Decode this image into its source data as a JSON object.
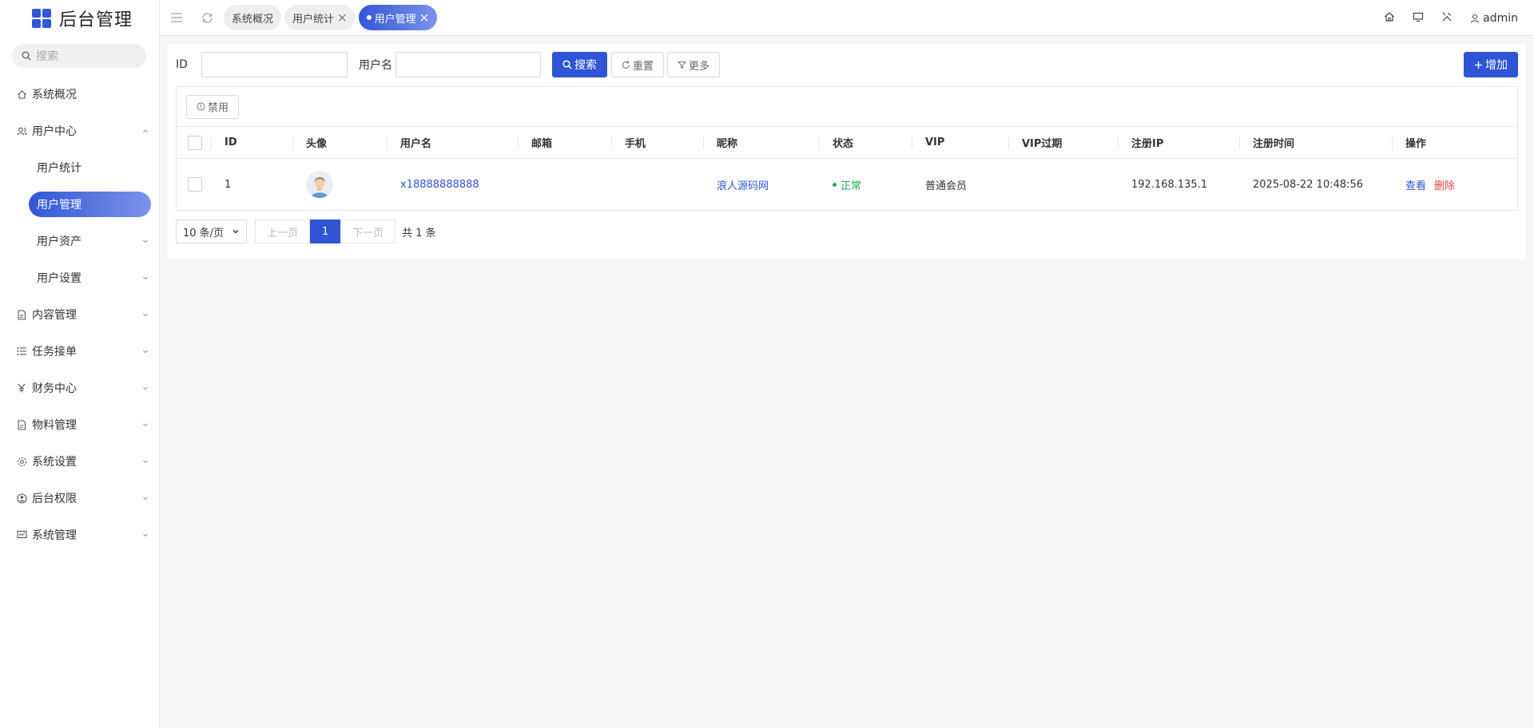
{
  "app": {
    "title": "后台管理"
  },
  "sidebar": {
    "search_placeholder": "搜索",
    "items": [
      {
        "label": "系统概况",
        "icon": "home-icon"
      },
      {
        "label": "用户中心",
        "icon": "users-icon",
        "expanded": true
      },
      {
        "label": "用户统计",
        "sub": true
      },
      {
        "label": "用户管理",
        "sub": true,
        "active": true
      },
      {
        "label": "用户资产",
        "sub": true
      },
      {
        "label": "用户设置",
        "sub": true
      },
      {
        "label": "内容管理",
        "icon": "document-icon"
      },
      {
        "label": "任务接单",
        "icon": "list-icon"
      },
      {
        "label": "财务中心",
        "icon": "yen-icon"
      },
      {
        "label": "物料管理",
        "icon": "document-icon"
      },
      {
        "label": "系统设置",
        "icon": "gear-icon"
      },
      {
        "label": "后台权限",
        "icon": "user-circle-icon"
      },
      {
        "label": "系统管理",
        "icon": "monitor-icon"
      }
    ]
  },
  "topbar": {
    "tabs": [
      {
        "label": "系统概况"
      },
      {
        "label": "用户统计"
      },
      {
        "label": "用户管理",
        "active": true
      }
    ],
    "user": "admin"
  },
  "filter": {
    "id_label": "ID",
    "username_label": "用户名",
    "search_label": "搜索",
    "reset_label": "重置",
    "more_label": "更多",
    "add_label": "增加"
  },
  "table": {
    "toolbar_disable": "禁用",
    "columns": [
      "ID",
      "头像",
      "用户名",
      "邮箱",
      "手机",
      "昵称",
      "状态",
      "VIP",
      "VIP过期",
      "注册IP",
      "注册时间",
      "操作"
    ],
    "rows": [
      {
        "id": "1",
        "username": "x18888888888",
        "email": "",
        "phone": "",
        "nickname": "浪人源码网",
        "status": "正常",
        "vip": "普通会员",
        "vip_expire": "",
        "ip": "192.168.135.1",
        "reg_time": "2025-08-22 10:48:56",
        "view": "查看",
        "delete": "删除"
      }
    ]
  },
  "pager": {
    "page_size": "10 条/页",
    "prev": "上一页",
    "current": "1",
    "next": "下一页",
    "total": "共 1 条"
  },
  "colors": {
    "primary": "#2f55d4",
    "success": "#31a354",
    "danger": "#e54545"
  }
}
